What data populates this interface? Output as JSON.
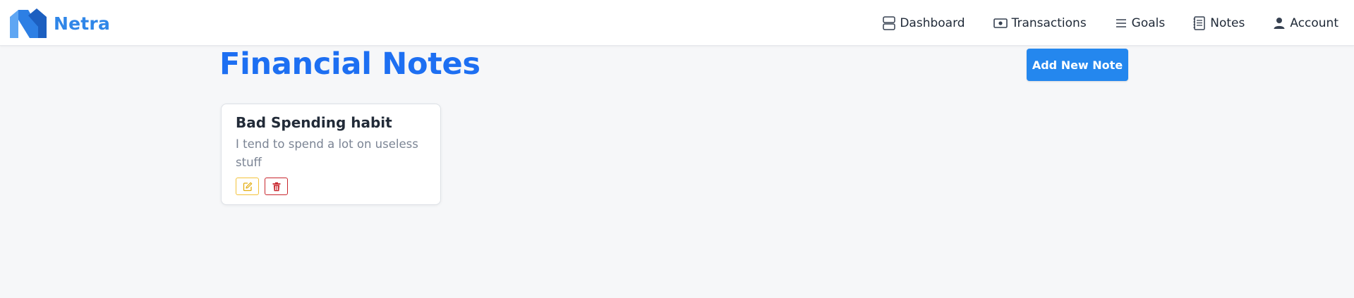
{
  "navbar": {
    "brand": {
      "name": "Netra",
      "logo_icon": "netra-n-logo",
      "color": "#2f86e8"
    },
    "links": [
      {
        "label": "Dashboard",
        "icon": "dashboard-icon"
      },
      {
        "label": "Transactions",
        "icon": "cash-icon"
      },
      {
        "label": "Goals",
        "icon": "list-icon"
      },
      {
        "label": "Notes",
        "icon": "notebook-icon"
      },
      {
        "label": "Account",
        "icon": "user-icon"
      }
    ]
  },
  "page": {
    "title": "Financial Notes",
    "title_color": "#1d6ff2",
    "add_button_label": "Add New Note",
    "add_button_color": "#2487ee"
  },
  "notes": [
    {
      "title": "Bad Spending habit",
      "body": "I tend to spend a lot on useless stuff",
      "actions": [
        {
          "name": "edit",
          "icon": "edit-icon",
          "color": "#f3c23a"
        },
        {
          "name": "delete",
          "icon": "trash-icon",
          "color": "#c8262d"
        }
      ]
    }
  ],
  "colors": {
    "background": "#f6f7f9",
    "navbar_bg": "#ffffff",
    "card_bg": "#ffffff"
  }
}
